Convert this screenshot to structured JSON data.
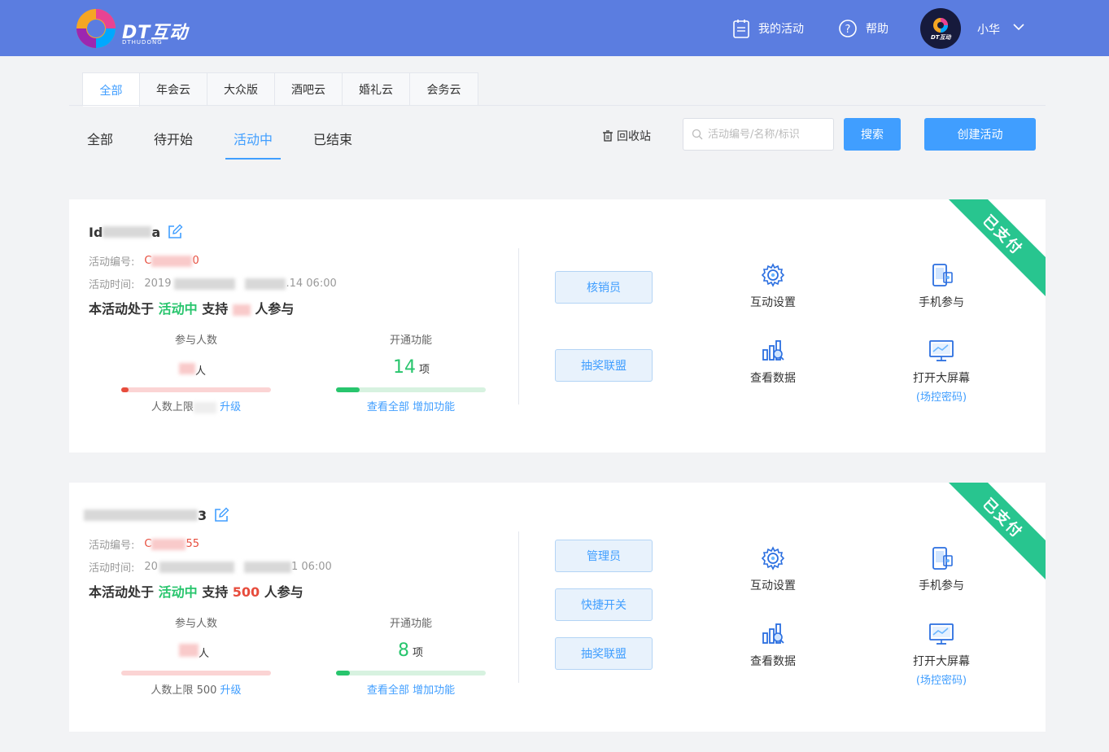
{
  "header": {
    "logo_text": "DT互动",
    "logo_sub": "DTHUDONG",
    "my_activities": "我的活动",
    "help": "帮助",
    "avatar_label": "DT互动",
    "user_name": "小华"
  },
  "category_tabs": [
    "全部",
    "年会云",
    "大众版",
    "酒吧云",
    "婚礼云",
    "会务云"
  ],
  "status_tabs": [
    "全部",
    "待开始",
    "活动中",
    "已结束"
  ],
  "toolbar": {
    "recycle": "回收站",
    "search_placeholder": "活动编号/名称/标识",
    "search_button": "搜索",
    "create_button": "创建活动"
  },
  "cards": [
    {
      "ribbon": "已支付",
      "title_prefix": "Id",
      "title_suffix": "a",
      "code_label": "活动编号:",
      "code_prefix": "C",
      "code_suffix": "0",
      "time_label": "活动时间:",
      "time_prefix": "2019",
      "time_suffix": ".14 06:00",
      "status_prefix": "本活动处于",
      "status_value": "活动中",
      "status_mid": "支持",
      "status_count": "",
      "status_suffix": "人参与",
      "participants_label": "参与人数",
      "participants_value": "",
      "participants_unit": "人",
      "participants_progress": 0.05,
      "limit_prefix": "人数上限",
      "limit_value": "",
      "upgrade": "升级",
      "features_label": "开通功能",
      "features_count": "14",
      "features_unit": "项",
      "features_progress": 0.16,
      "view_all": "查看全部",
      "add_feature": "增加功能",
      "roles": [
        "核销员",
        "抽奖联盟"
      ],
      "functions": {
        "interact_settings": "互动设置",
        "mobile_join": "手机参与",
        "view_data": "查看数据",
        "open_screen": "打开大屏幕",
        "screen_code": "(场控密码)"
      }
    },
    {
      "ribbon": "已支付",
      "title_prefix": "",
      "title_suffix": "3",
      "code_label": "活动编号:",
      "code_prefix": "C",
      "code_suffix": "55",
      "time_label": "活动时间:",
      "time_prefix": "20",
      "time_suffix": "1 06:00",
      "status_prefix": "本活动处于",
      "status_value": "活动中",
      "status_mid": "支持",
      "status_count": "500",
      "status_suffix": "人参与",
      "participants_label": "参与人数",
      "participants_value": "",
      "participants_unit": "人",
      "participants_progress": 0.0,
      "limit_prefix": "人数上限",
      "limit_value": "500",
      "upgrade": "升级",
      "features_label": "开通功能",
      "features_count": "8",
      "features_unit": "项",
      "features_progress": 0.09,
      "view_all": "查看全部",
      "add_feature": "增加功能",
      "roles": [
        "管理员",
        "快捷开关",
        "抽奖联盟"
      ],
      "functions": {
        "interact_settings": "互动设置",
        "mobile_join": "手机参与",
        "view_data": "查看数据",
        "open_screen": "打开大屏幕",
        "screen_code": "(场控密码)"
      }
    }
  ],
  "colors": {
    "header_bg": "#5b7de0",
    "primary": "#409eff",
    "ribbon": "#28c58f",
    "status_green": "#28c56d",
    "red": "#e74c3c"
  }
}
